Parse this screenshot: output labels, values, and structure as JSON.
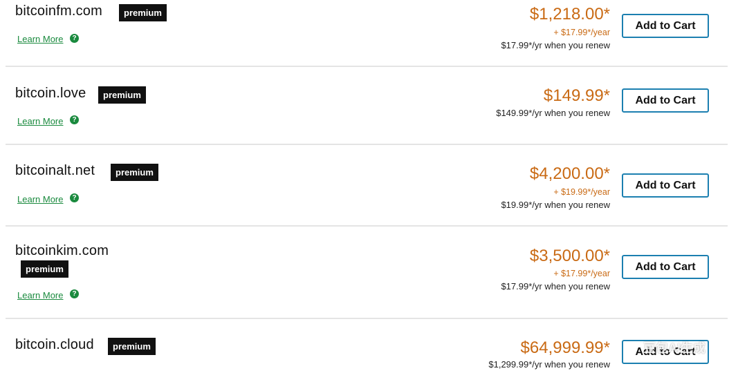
{
  "results": [
    {
      "domain": "bitcoinfm.com",
      "badge": "premium",
      "learn_more": "Learn More",
      "price": "$1,218.00*",
      "renewal_fee": "+ $17.99*/year",
      "renew_note": "$17.99*/yr when you renew",
      "cta": "Add to Cart"
    },
    {
      "domain": "bitcoin.love",
      "badge": "premium",
      "learn_more": "Learn More",
      "price": "$149.99*",
      "renew_note": "$149.99*/yr when you renew",
      "cta": "Add to Cart"
    },
    {
      "domain": "bitcoinalt.net",
      "badge": "premium",
      "learn_more": "Learn More",
      "price": "$4,200.00*",
      "renewal_fee": "+ $19.99*/year",
      "renew_note": "$19.99*/yr when you renew",
      "cta": "Add to Cart"
    },
    {
      "domain": "bitcoinkim.com",
      "badge": "premium",
      "learn_more": "Learn More",
      "price": "$3,500.00*",
      "renewal_fee": "+ $17.99*/year",
      "renew_note": "$17.99*/yr when you renew",
      "cta": "Add to Cart"
    },
    {
      "domain": "bitcoin.cloud",
      "badge": "premium",
      "price": "$64,999.99*",
      "renew_note": "$1,299.99*/yr when you renew",
      "cta": "Add to Cart"
    }
  ],
  "help_icon_glyph": "?",
  "watermark": "豆包AI生成",
  "colors": {
    "price": "#c96a14",
    "learn_more": "#1a8a3e",
    "badge_bg": "#111111",
    "button_border": "#1b7fb0",
    "separator": "#e4e4e4"
  },
  "icons": [
    "help-icon"
  ]
}
